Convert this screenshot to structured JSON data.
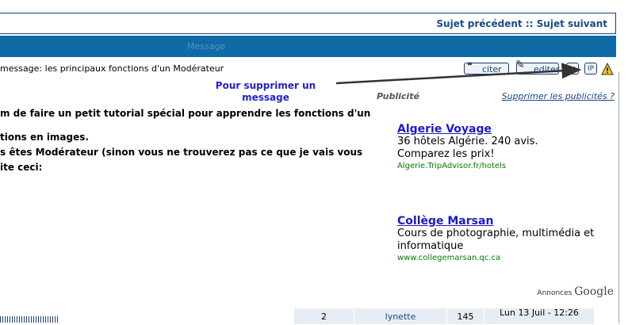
{
  "nav": {
    "prev": "Sujet précédent",
    "sep": "::",
    "next": "Sujet suivant"
  },
  "bar": {
    "title": "Message"
  },
  "post": {
    "subject": "message: les principaux fonctions d'un Modérateur",
    "buttons": {
      "quote": "citer",
      "edit": "editer",
      "delete": "✕",
      "ip": "IP"
    },
    "lines": [
      "m de faire un petit tutorial spécial pour apprendre les fonctions d'un",
      "tions en images.",
      "s êtes Modérateur (sinon vous ne trouverez pas ce que je vais vous",
      "ite ceci:"
    ]
  },
  "annotation": {
    "text": "Pour supprimer un message"
  },
  "ads": {
    "label": "Publicité",
    "remove": "Supprimer les publicités ?",
    "items": [
      {
        "title": "Algerie Voyage",
        "desc": "36 hôtels Algérie. 240 avis. Comparez les prix!",
        "url": "Algerie.TripAdvisor.fr/hotels"
      },
      {
        "title": "Collège Marsan",
        "desc": "Cours de photographie, multimédia et informatique",
        "url": "www.collegemarsan.qc.ca"
      }
    ],
    "footer_prefix": "Annonces",
    "footer_brand": "Google"
  },
  "table": {
    "cells": [
      "2",
      "lynette",
      "145",
      "Lun 13 Juil - 12:26"
    ]
  },
  "colors": {
    "accent": "#0e6ba6",
    "link": "#1a4a8a",
    "annotation": "#2222cc",
    "adurl": "#008000"
  },
  "icons": [
    "quote-icon",
    "edit-icon",
    "delete-icon",
    "ip-icon",
    "warning-icon"
  ]
}
